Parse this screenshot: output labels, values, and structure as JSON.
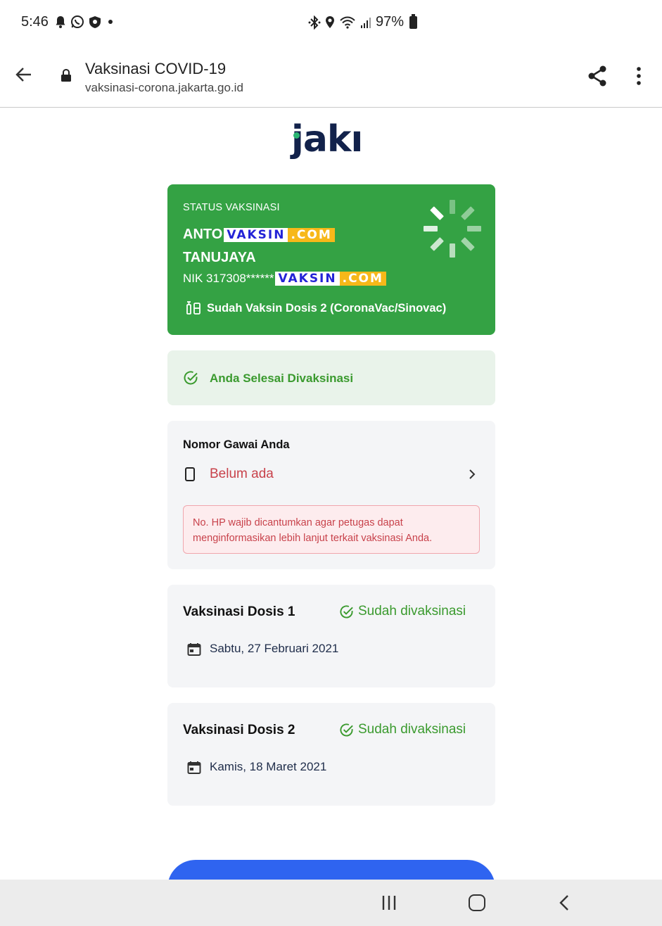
{
  "status_bar": {
    "time": "5:46",
    "battery": "97%",
    "icons": [
      "bell-icon",
      "whatsapp-icon",
      "shield-app-icon",
      "dot-icon",
      "bluetooth-icon",
      "location-icon",
      "wifi-icon",
      "signal-icon",
      "battery-icon"
    ]
  },
  "browser": {
    "title": "Vaksinasi COVID-19",
    "url": "vaksinasi-corona.jakarta.go.id"
  },
  "logo": {
    "text": "jakı"
  },
  "vaccine_card": {
    "label": "STATUS VAKSINASI",
    "name_line1": "ANTO",
    "name_line2": "TANUJAYA",
    "nik": "NIK 317308******",
    "watermark_a": "VAKSIN",
    "watermark_b": ".COM",
    "dose_status": "Sudah Vaksin Dosis 2 (CoronaVac/Sinovac)",
    "background_color": "#34a244"
  },
  "done_banner": {
    "text": "Anda Selesai Divaksinasi"
  },
  "phone_card": {
    "title": "Nomor Gawai Anda",
    "value": "Belum ada",
    "warning": "No. HP wajib dicantumkan agar petugas dapat menginformasikan lebih lanjut terkait vaksinasi Anda."
  },
  "doses": [
    {
      "title": "Vaksinasi Dosis 1",
      "status": "Sudah divaksinasi",
      "date": "Sabtu, 27 Februari 2021"
    },
    {
      "title": "Vaksinasi Dosis 2",
      "status": "Sudah divaksinasi",
      "date": "Kamis, 18 Maret 2021"
    }
  ],
  "colors": {
    "accent_blue": "#2f64f0",
    "success_green": "#3a9a2e",
    "error_red": "#c8424b"
  }
}
